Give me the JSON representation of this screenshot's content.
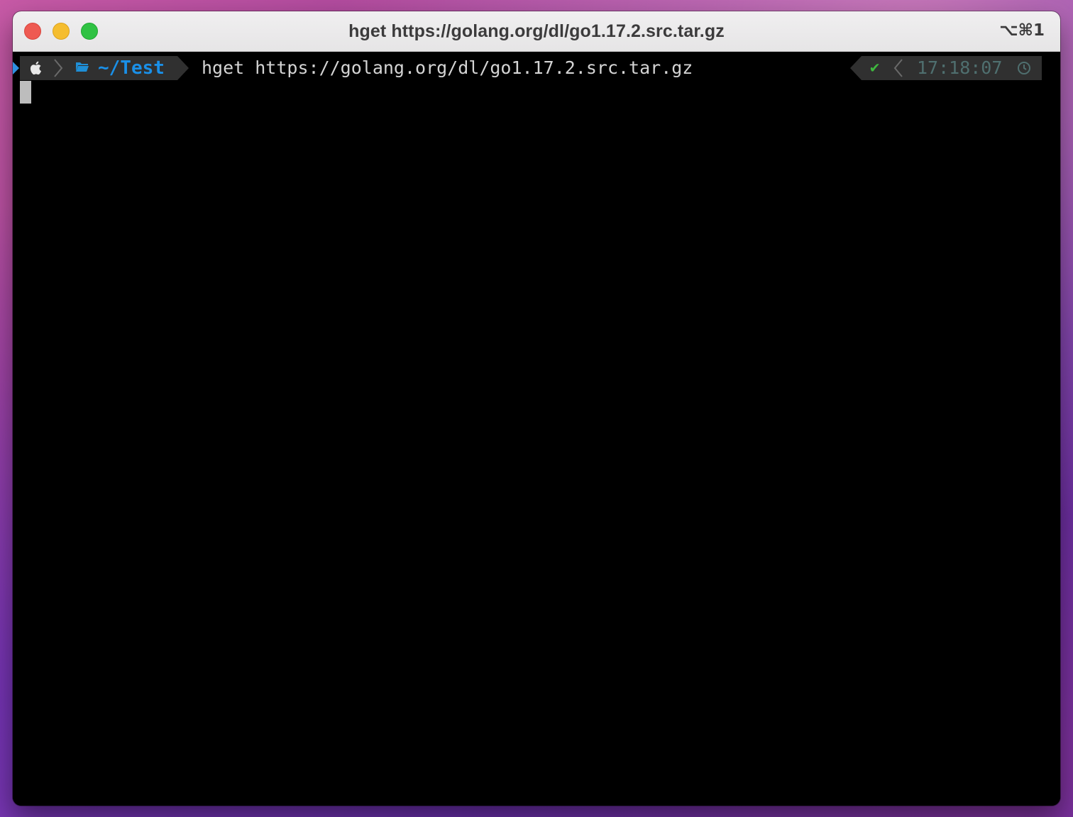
{
  "window": {
    "title": "hget https://golang.org/dl/go1.17.2.src.tar.gz",
    "shortcut": "⌥⌘1"
  },
  "prompt": {
    "os_icon": "apple-icon",
    "dir_icon": "folder-icon",
    "cwd": "~/Test",
    "command": "hget https://golang.org/dl/go1.17.2.src.tar.gz",
    "status_icon": "check-icon",
    "status_glyph": "✔",
    "time": "17:18:07",
    "time_icon": "clock-icon"
  },
  "colors": {
    "cwd": "#1a90e8",
    "status_ok": "#3fb83f",
    "time": "#4f6f6f",
    "segment_bg": "#303030"
  }
}
